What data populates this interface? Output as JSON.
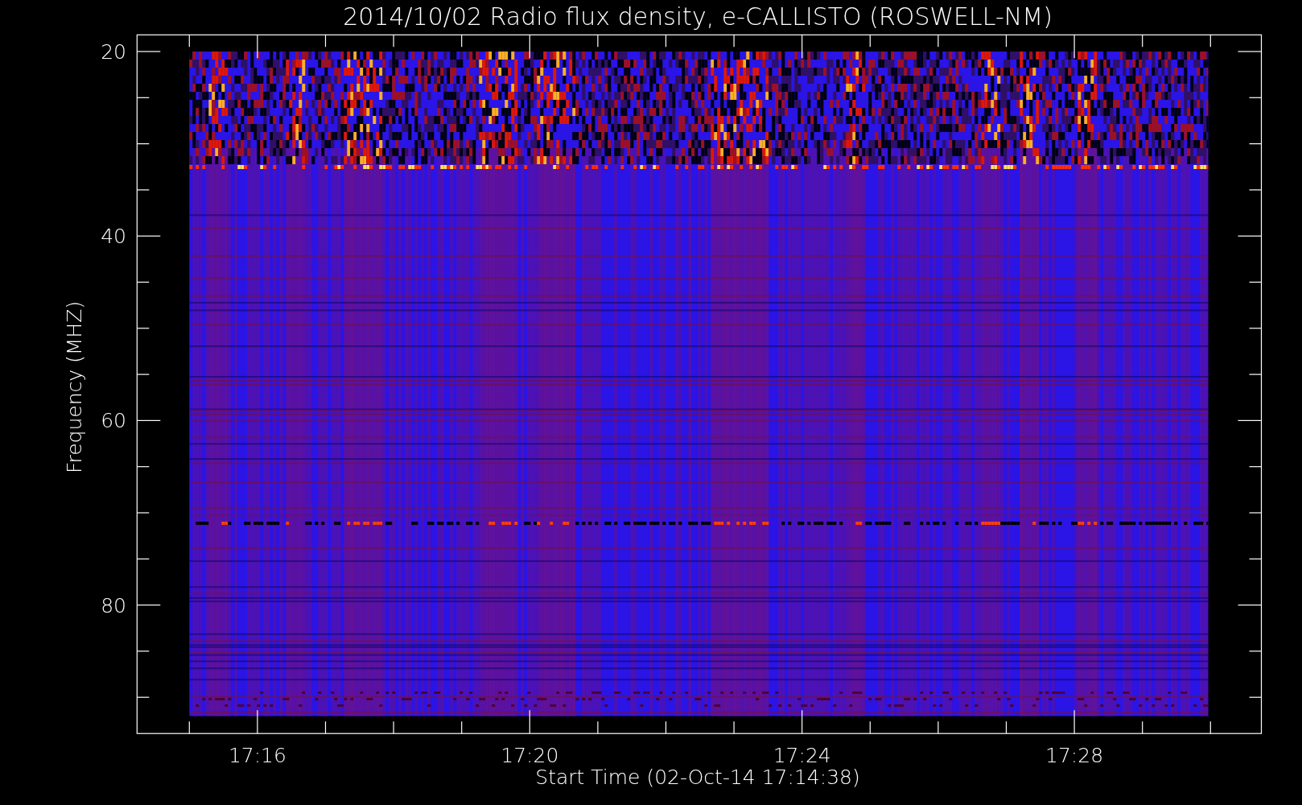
{
  "title": "2014/10/02  Radio flux density, e-CALLISTO (ROSWELL-NM)",
  "y_axis": {
    "label": "Frequency (MHZ)",
    "ticks": [
      "20",
      "40",
      "60",
      "80"
    ]
  },
  "x_axis": {
    "label": "Start Time (02-Oct-14 17:14:38)",
    "ticks": [
      "17:16",
      "17:20",
      "17:24",
      "17:28"
    ]
  }
}
